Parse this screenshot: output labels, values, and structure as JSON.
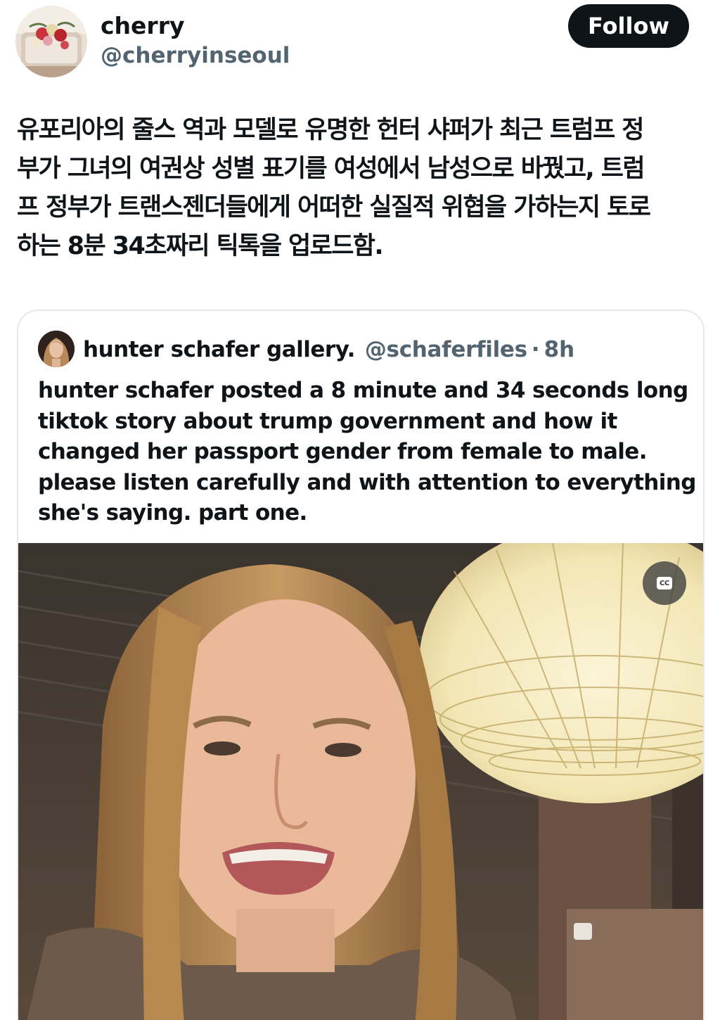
{
  "author": {
    "display_name": "cherry",
    "handle": "@cherryinseoul",
    "avatar_icon": "bouquet-photo-avatar"
  },
  "follow_button": {
    "label": "Follow"
  },
  "tweet": {
    "lines": [
      "유포리아의 줄스 역과 모델로 유명한 헌터 샤퍼가 최근 트럼프 정",
      "부가 그녀의 여권상 성별 표기를 여성에서 남성으로 바꿨고, 트럼",
      "프 정부가 트랜스젠더들에게 어떠한 실질적 위협을 가하는지 토로",
      "하는 8분 34초짜리 틱톡을 업로드함."
    ]
  },
  "quoted_tweet": {
    "display_name": "hunter schafer gallery.",
    "handle": "@schaferfiles",
    "separator": "·",
    "time": "8h",
    "avatar_icon": "portrait-avatar",
    "lines": [
      "hunter schafer posted a 8 minute and 34 seconds long",
      "tiktok story about trump government and how it",
      "changed her passport gender from female to male.",
      "please listen carefully and with attention to everything",
      "she's saying. part one."
    ],
    "media": {
      "type": "video",
      "captions_button_label": "CC",
      "captions_icon": "closed-captions-icon"
    }
  },
  "colors": {
    "text_primary": "#0f1419",
    "text_secondary": "#536471",
    "button_bg": "#0f1419",
    "button_text": "#ffffff",
    "card_border": "#e6e9ec"
  }
}
